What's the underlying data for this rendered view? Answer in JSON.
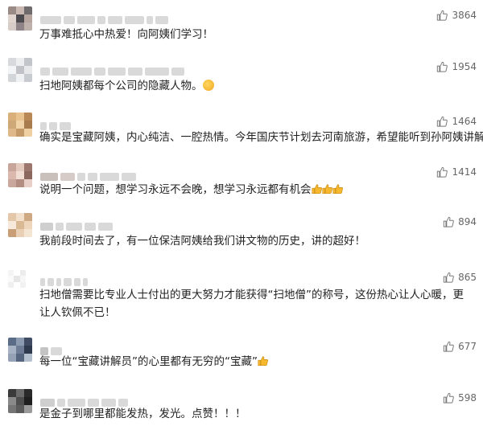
{
  "comments": [
    {
      "text": "万事难抵心中热爱！向阿姨们学习！",
      "likes": "3864",
      "avatar_colors": [
        "#9a8b86",
        "#c9b9b2",
        "#6f6a6c",
        "#e0d4cf",
        "#4c4a4e",
        "#b7a6a0",
        "#d8ccc8",
        "#8e8386",
        "#bfb1ab"
      ]
    },
    {
      "text": "扫地阿姨都每个公司的隐藏人物。",
      "likes": "1954",
      "avatar_colors": [
        "#d7d9dc",
        "#eceef0",
        "#c2c6ca",
        "#f3f4f5",
        "#bfc3c7",
        "#e6e8ea",
        "#d3d6d9",
        "#f0f1f2",
        "#c8ccd0"
      ]
    },
    {
      "text": "确实是宝藏阿姨，内心纯洁、一腔热情。今年国庆节计划去河南旅游，希望能听到孙阿姨讲解。",
      "likes": "1464",
      "avatar_colors": [
        "#d9b07a",
        "#e8c28f",
        "#b98955",
        "#cfa878",
        "#f1d3a8",
        "#a87c4d",
        "#e0b98b",
        "#c49a69",
        "#efd0a2"
      ]
    },
    {
      "text": "说明一个问题，想学习永远不会晚，想学习永远都有机会",
      "likes": "1414",
      "avatar_colors": [
        "#c7a59a",
        "#e4c9bf",
        "#9c776d",
        "#dab8ad",
        "#f2ddd5",
        "#8c675e",
        "#caa79c",
        "#b38d82",
        "#e8d0c8"
      ]
    },
    {
      "text": "我前段时间去了，有一位保洁阿姨给我们讲文物的历史，讲的超好！",
      "likes": "894",
      "avatar_colors": [
        "#e3c7a8",
        "#f2e0cc",
        "#cfa983",
        "#f6e9db",
        "#d9b894",
        "#eed6bc",
        "#c89e76",
        "#e9cfb3",
        "#f4e4d2"
      ]
    },
    {
      "text": "扫地僧需要比专业人士付出的更大努力才能获得“扫地僧”的称号，这份热心让人心暖，更让人钦佩不已！",
      "likes": "865",
      "avatar_colors": [
        "#f4f4f4",
        "#ffffff",
        "#ececec",
        "#fafafa",
        "#e6e6e6",
        "#f7f7f7",
        "#efefef",
        "#ffffff",
        "#f2f2f2"
      ]
    },
    {
      "text": "每一位“宝藏讲解员”的心里都有无穷的“宝藏”",
      "likes": "677",
      "avatar_colors": [
        "#5b6c86",
        "#8d9bb1",
        "#3f4c63",
        "#a7b3c5",
        "#6e7d95",
        "#2f3a4e",
        "#95a2b6",
        "#56657e",
        "#b5c0cf"
      ]
    },
    {
      "text": "是金子到哪里都能发热，发光。点赞！！！",
      "likes": "598",
      "avatar_colors": [
        "#3a3a3a",
        "#6b6b6b",
        "#2a2a2a",
        "#8a8a8a",
        "#4d4d4d",
        "#1f1f1f",
        "#757575",
        "#5a5a5a",
        "#9a9a9a"
      ]
    }
  ]
}
